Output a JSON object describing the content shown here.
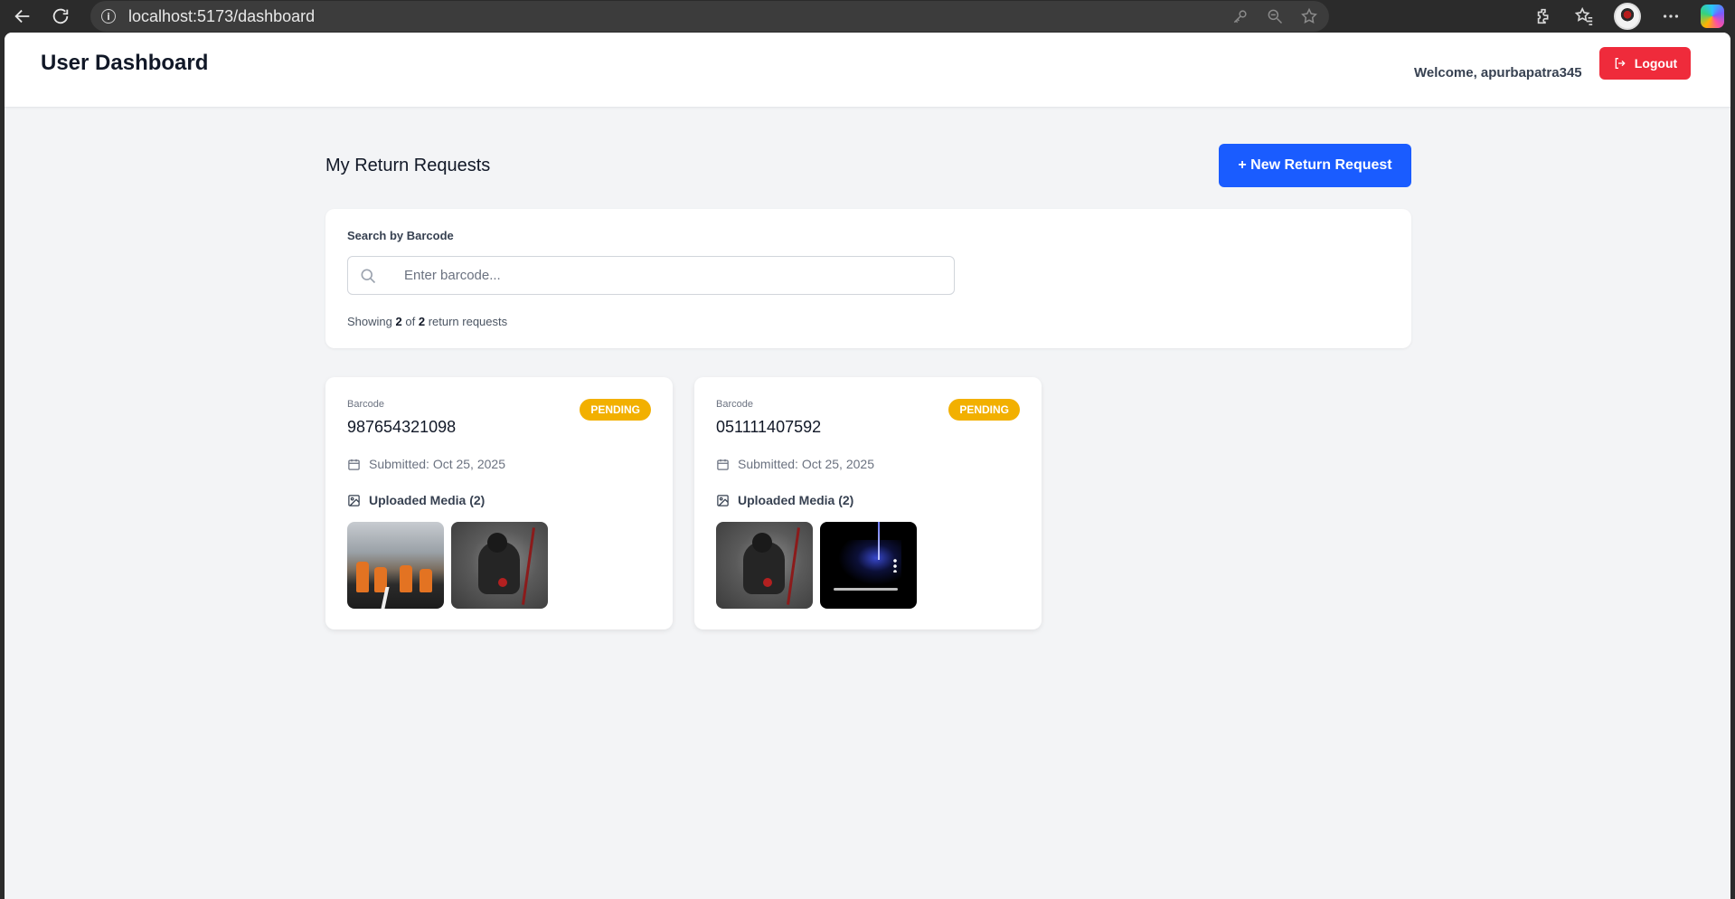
{
  "browser": {
    "url": "localhost:5173/dashboard"
  },
  "header": {
    "title": "User Dashboard",
    "welcome": "Welcome, apurbapatra345",
    "logout_label": "Logout"
  },
  "main": {
    "section_title": "My Return Requests",
    "new_request_label": "+ New Return Request",
    "search": {
      "label": "Search by Barcode",
      "placeholder": "Enter barcode...",
      "value": "",
      "showing_prefix": "Showing",
      "shown": "2",
      "of": "of",
      "total": "2",
      "suffix": "return requests"
    },
    "requests": [
      {
        "barcode_label": "Barcode",
        "barcode": "987654321098",
        "status": "PENDING",
        "submitted": "Submitted: Oct 25, 2025",
        "media_title": "Uploaded Media (2)",
        "media": [
          "street-workers-image",
          "samurai-image"
        ]
      },
      {
        "barcode_label": "Barcode",
        "barcode": "051111407592",
        "status": "PENDING",
        "submitted": "Submitted: Oct 25, 2025",
        "media_title": "Uploaded Media (2)",
        "media": [
          "samurai-image",
          "video-thumbnail"
        ]
      }
    ]
  },
  "colors": {
    "primary": "#1a5cff",
    "danger": "#ef2b3b",
    "pending": "#f2b000",
    "background": "#f3f4f6"
  }
}
